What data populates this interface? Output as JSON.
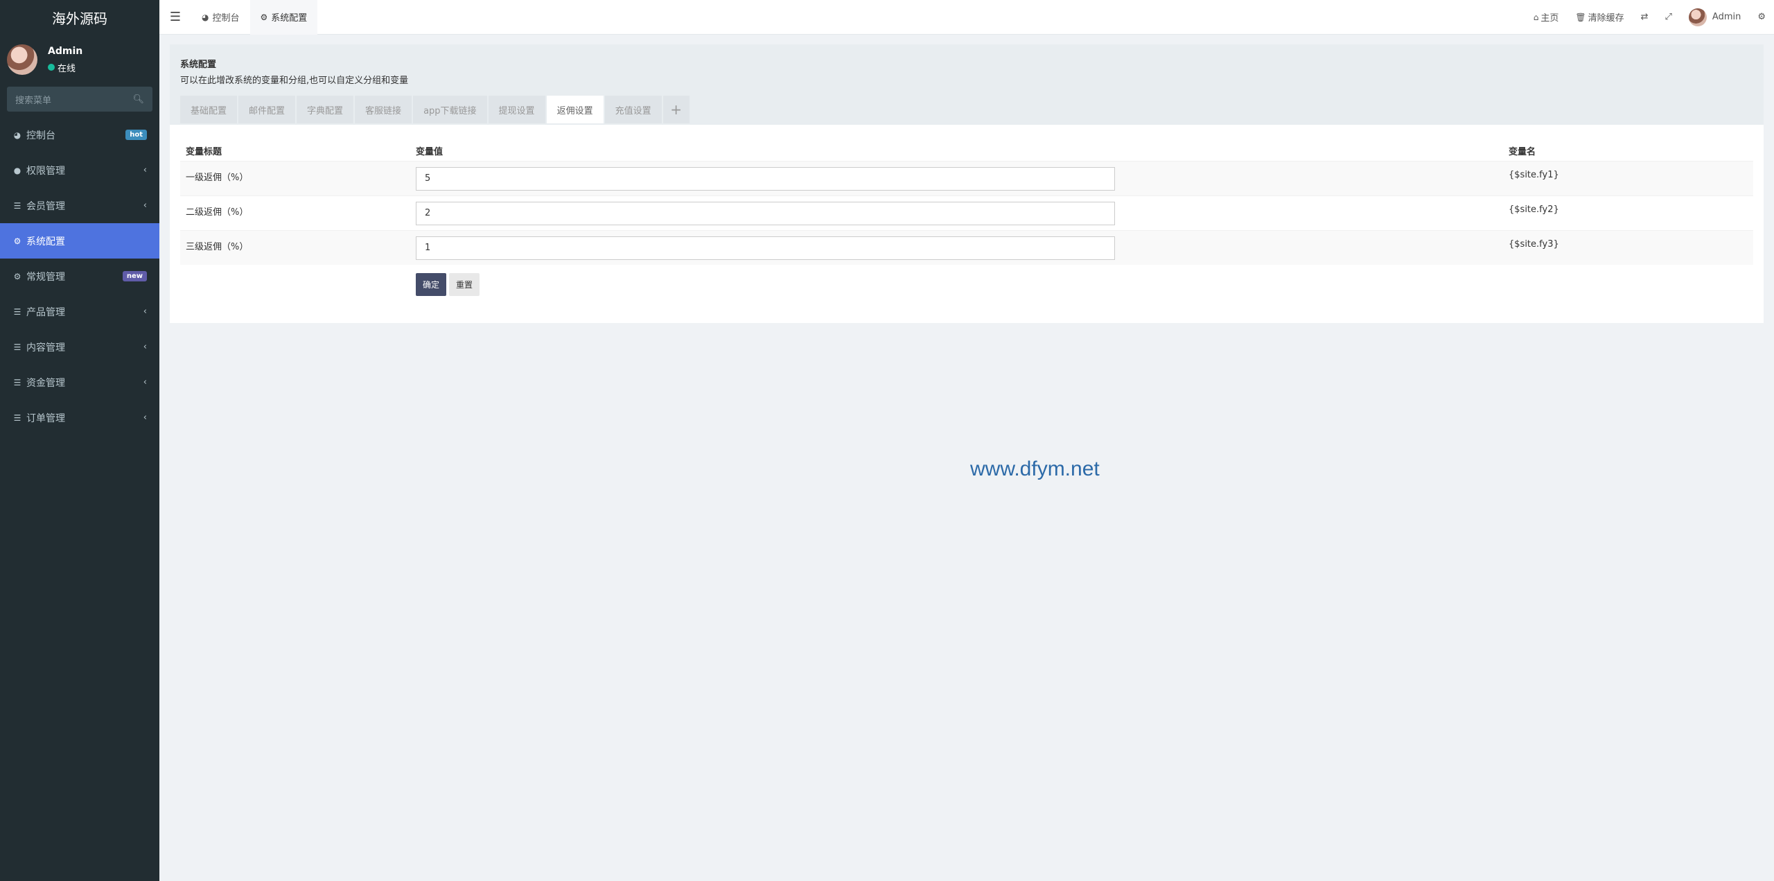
{
  "sidebar": {
    "logo": "海外源码",
    "user": {
      "name": "Admin",
      "status": "在线"
    },
    "search_placeholder": "搜索菜单",
    "items": [
      {
        "label": "控制台",
        "icon": "dashboard-icon",
        "badge": "hot"
      },
      {
        "label": "权限管理",
        "icon": "users-icon"
      },
      {
        "label": "会员管理",
        "icon": "list-icon"
      },
      {
        "label": "系统配置",
        "icon": "gear-icon"
      },
      {
        "label": "常规管理",
        "icon": "cogs-icon",
        "badge": "new"
      },
      {
        "label": "产品管理",
        "icon": "list-icon"
      },
      {
        "label": "内容管理",
        "icon": "list-icon"
      },
      {
        "label": "资金管理",
        "icon": "list-icon"
      },
      {
        "label": "订单管理",
        "icon": "list-icon"
      }
    ]
  },
  "navbar": {
    "tabs": [
      {
        "label": "控制台",
        "icon": "dashboard-icon"
      },
      {
        "label": "系统配置",
        "icon": "gear-icon"
      }
    ],
    "right": {
      "home": "主页",
      "clear_cache": "清除缓存",
      "user": "Admin"
    }
  },
  "panel": {
    "title": "系统配置",
    "description": "可以在此增改系统的变量和分组,也可以自定义分组和变量",
    "tabs": [
      "基础配置",
      "邮件配置",
      "字典配置",
      "客服链接",
      "app下载链接",
      "提现设置",
      "返佣设置",
      "充值设置"
    ],
    "active_tab": "返佣设置",
    "table": {
      "headers": [
        "变量标题",
        "变量值",
        "变量名"
      ],
      "rows": [
        {
          "title": "一级返佣（%）",
          "value": "5",
          "name": "{$site.fy1}"
        },
        {
          "title": "二级返佣（%）",
          "value": "2",
          "name": "{$site.fy2}"
        },
        {
          "title": "三级返佣（%）",
          "value": "1",
          "name": "{$site.fy3}"
        }
      ]
    },
    "buttons": {
      "confirm": "确定",
      "reset": "重置"
    }
  },
  "watermark": "www.dfym.net",
  "colors": {
    "sidebar_bg": "#222d32",
    "active": "#4e73df",
    "primary_btn": "#444c69"
  }
}
